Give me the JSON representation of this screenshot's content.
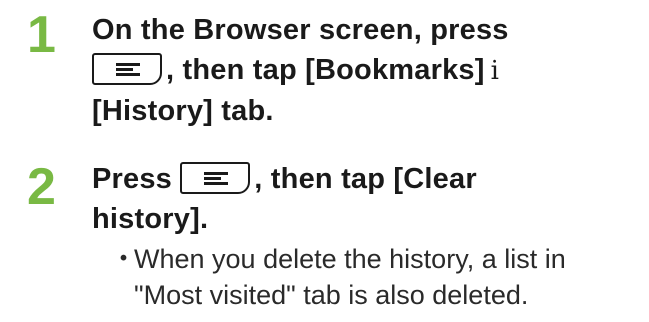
{
  "steps": [
    {
      "number": "1",
      "line1": "On the Browser screen, press",
      "line2_after_key": ", then tap [Bookmarks]",
      "arrow": "i",
      "line3": "[History] tab."
    },
    {
      "number": "2",
      "line1_before_key": "Press",
      "line1_after_key": ", then tap [Clear",
      "line2": "history].",
      "note_bullet": "・",
      "note_line1": "When you delete the history, a list in",
      "note_line2": "\"Most visited\" tab is also deleted."
    }
  ],
  "icons": {
    "menu_key": "menu-key-icon"
  },
  "colors": {
    "step_number": "#79b944",
    "text": "#1a1a1a"
  }
}
